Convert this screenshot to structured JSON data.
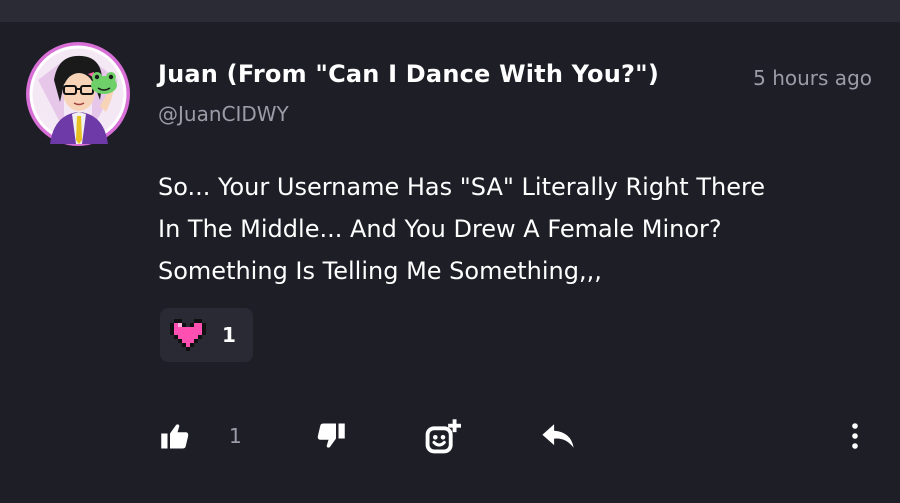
{
  "comment": {
    "author": "Juan (From \"Can I Dance With You?\")",
    "handle": "@JuanCIDWY",
    "timestamp": "5 hours ago",
    "body_lines": [
      "So... Your Username Has \"SA\" Literally Right There",
      "In The Middle... And You Drew A Female Minor?",
      "Something Is Telling Me Something,,,"
    ]
  },
  "reaction": {
    "icon": "pixel-heart-icon",
    "count": "1",
    "color": "#ff4fb0"
  },
  "actions": {
    "like_count": "1",
    "icons": [
      "thumbs-up-icon",
      "thumbs-down-icon",
      "add-reaction-icon",
      "reply-icon",
      "more-vertical-icon"
    ]
  },
  "colors": {
    "background": "#1e1e27",
    "text_primary": "#ffffff",
    "text_secondary": "#9c9ca8",
    "chip_bg": "#2a2a34",
    "avatar_ring": "#c85ac8"
  }
}
